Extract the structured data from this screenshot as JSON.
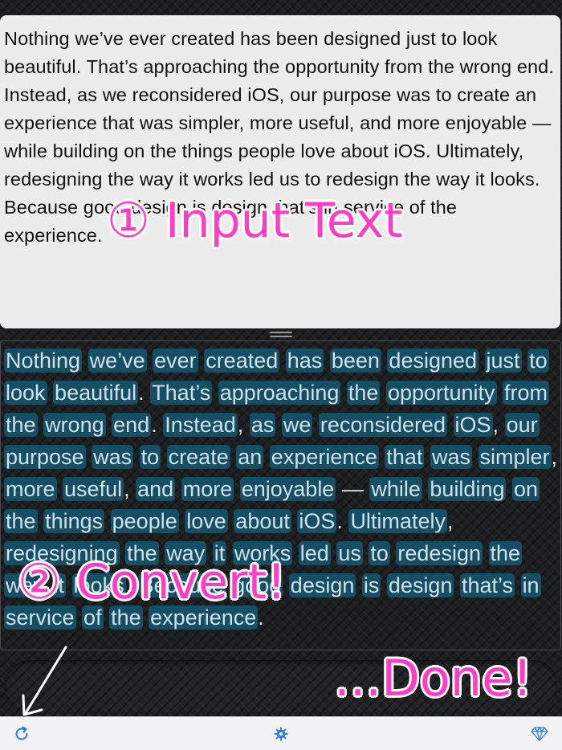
{
  "input": {
    "text": "Nothing we’ve ever created has been designed just to look beautiful. That’s approaching the opportunity from the wrong end. Instead, as we reconsidered iOS, our purpose was to create an experience that was simpler, more useful, and more enjoyable — while building on the things people love about iOS. Ultimately, redesigning the way it works led us to redesign the way it looks. Because good design is design that’s in service of the experience."
  },
  "output": {
    "tokens": [
      "Nothing",
      "we’ve",
      "ever",
      "created",
      "has",
      "been",
      "designed",
      "just",
      "to",
      "look",
      "beautiful",
      ".",
      "That’s",
      "approaching",
      "the",
      "opportunity",
      "from",
      "the",
      "wrong",
      "end",
      ".",
      "Instead",
      ",",
      "as",
      "we",
      "reconsidered",
      "iOS",
      ",",
      "our",
      "purpose",
      "was",
      "to",
      "create",
      "an",
      "experience",
      "that",
      "was",
      "simpler",
      ",",
      "more",
      "useful",
      ",",
      "and",
      "more",
      "enjoyable",
      "—",
      "while",
      "building",
      "on",
      "the",
      "things",
      "people",
      "love",
      "about",
      "iOS",
      ".",
      "Ultimately",
      ",",
      "redesigning",
      "the",
      "way",
      "it",
      "works",
      "led",
      "us",
      "to",
      "redesign",
      "the",
      "way",
      "it",
      "looks",
      ".",
      "Because",
      "good",
      "design",
      "is",
      "design",
      "that’s",
      "in",
      "service",
      "of",
      "the",
      "experience",
      "."
    ]
  },
  "annotations": {
    "step1": "① Input Text",
    "step2": "② Convert!",
    "done": "...Done!"
  },
  "toolbar": {
    "refresh_icon": "refresh-icon",
    "settings_icon": "gear-icon",
    "diamond_icon": "diamond-icon",
    "accent": "#2a7de1"
  },
  "colors": {
    "chip": "#164f63",
    "annotation": "#ff3dc4"
  }
}
